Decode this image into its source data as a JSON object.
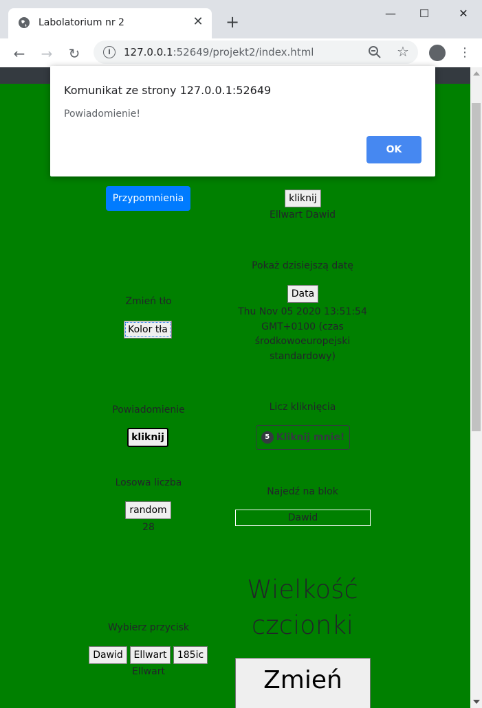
{
  "browser": {
    "tab_title": "Labolatorium nr 2",
    "tab_close": "✕",
    "new_tab": "+",
    "window_minimize": "—",
    "window_maximize": "☐",
    "window_close": "✕",
    "url_host": "127.0.0.1",
    "url_rest": ":52649/projekt2/index.html",
    "back": "←",
    "forward": "→",
    "reload": "↻",
    "menu": "⋮",
    "star": "☆",
    "info": "i"
  },
  "dialog": {
    "title": "Komunikat ze strony 127.0.0.1:52649",
    "message": "Powiadomienie!",
    "ok_label": "OK"
  },
  "page": {
    "reminders_button": "Przypomnienia",
    "click_button_top": "kliknij",
    "author_name": "Ellwart Dawid",
    "show_date_label": "Pokaż dzisiejszą datę",
    "date_button": "Data",
    "date_output": "Thu Nov 05 2020 13:51:54 GMT+0100 (czas środkowoeuropejski standardowy)",
    "change_bg_label": "Zmień tło",
    "bg_color_button": "Kolor tła",
    "notification_label": "Powiadomienie",
    "notification_button": "kliknij",
    "count_clicks_label": "Licz kliknięcia",
    "click_count": "5",
    "click_me_button": "Kliknij mnie!",
    "random_label": "Losowa liczba",
    "random_button": "random",
    "random_value": "28",
    "hover_label": "Najedź na blok",
    "hover_block_text": "Dawid",
    "font_size_heading": "Wielkość czcionki",
    "change_button": "Zmień",
    "choose_button_label": "Wybierz przycisk",
    "choice_buttons": [
      "Dawid",
      "Ellwart",
      "185ic"
    ],
    "choice_output": "Ellwart"
  },
  "colors": {
    "page_background": "#008000",
    "primary": "#007bff",
    "dialog_ok": "#4688f1"
  }
}
